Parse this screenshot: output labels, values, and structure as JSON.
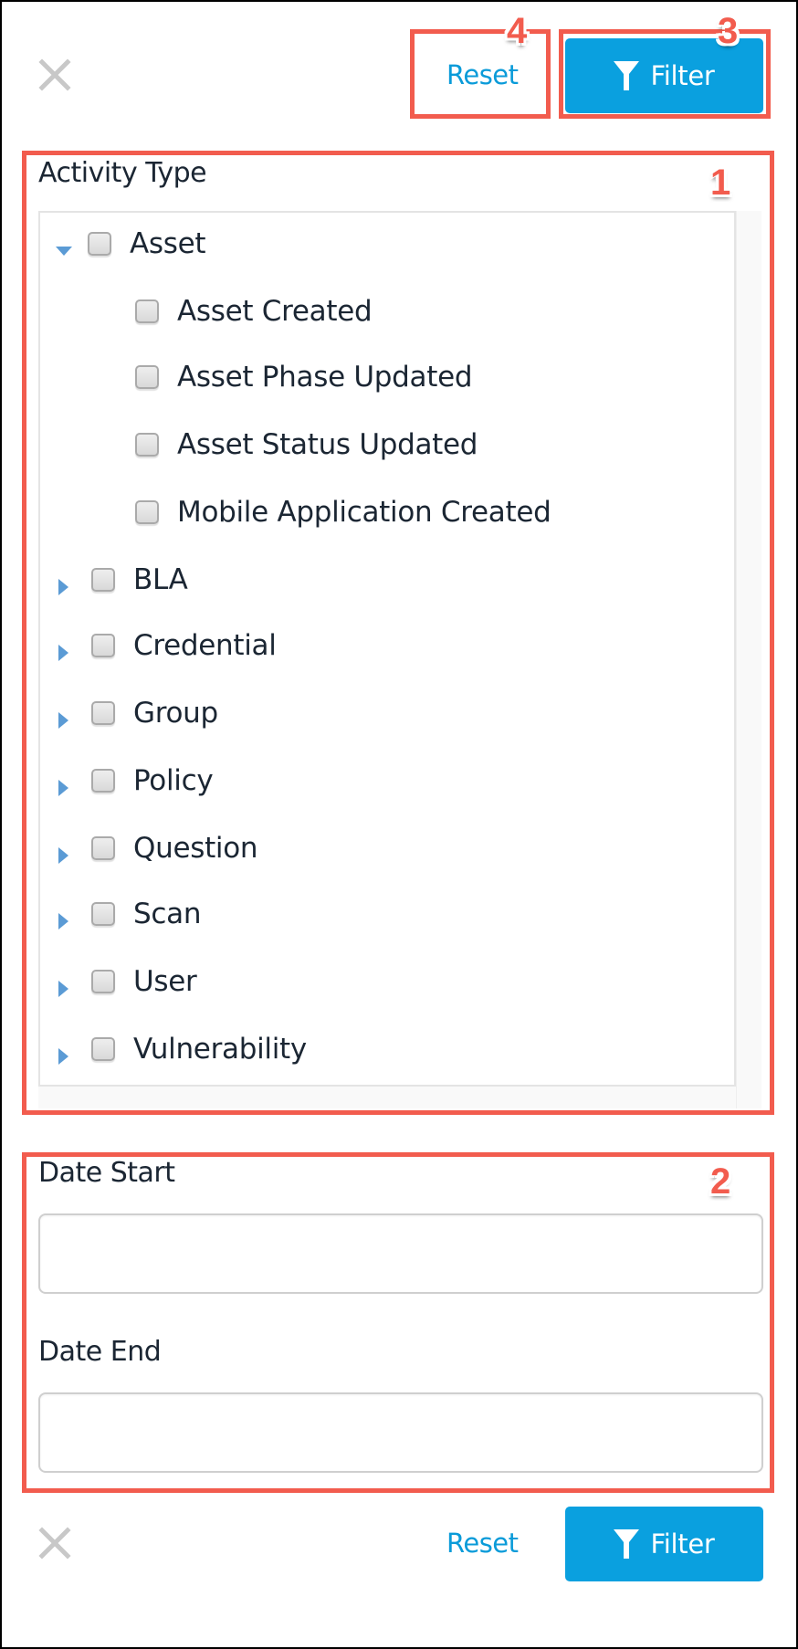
{
  "header": {
    "close_icon": "close-x-icon",
    "reset_label": "Reset",
    "filter_label": "Filter",
    "filter_icon": "funnel-icon"
  },
  "annotations": {
    "box1": "1",
    "box2": "2",
    "box3": "3",
    "box4": "4",
    "color": "#f25c4e"
  },
  "activity_type": {
    "label": "Activity Type",
    "tree": [
      {
        "label": "Asset",
        "expanded": true,
        "checked": false,
        "level": 0
      },
      {
        "label": "Asset Created",
        "checked": false,
        "level": 1
      },
      {
        "label": "Asset Phase Updated",
        "checked": false,
        "level": 1
      },
      {
        "label": "Asset Status Updated",
        "checked": false,
        "level": 1
      },
      {
        "label": "Mobile Application Created",
        "checked": false,
        "level": 1
      },
      {
        "label": "BLA",
        "expanded": false,
        "checked": false,
        "level": 0
      },
      {
        "label": "Credential",
        "expanded": false,
        "checked": false,
        "level": 0
      },
      {
        "label": "Group",
        "expanded": false,
        "checked": false,
        "level": 0
      },
      {
        "label": "Policy",
        "expanded": false,
        "checked": false,
        "level": 0
      },
      {
        "label": "Question",
        "expanded": false,
        "checked": false,
        "level": 0
      },
      {
        "label": "Scan",
        "expanded": false,
        "checked": false,
        "level": 0
      },
      {
        "label": "User",
        "expanded": false,
        "checked": false,
        "level": 0
      },
      {
        "label": "Vulnerability",
        "expanded": false,
        "checked": false,
        "level": 0
      }
    ]
  },
  "dates": {
    "start_label": "Date Start",
    "start_value": "",
    "start_placeholder": "",
    "end_label": "Date End",
    "end_value": "",
    "end_placeholder": ""
  },
  "footer": {
    "close_icon": "close-x-icon",
    "reset_label": "Reset",
    "filter_label": "Filter",
    "filter_icon": "funnel-icon"
  },
  "colors": {
    "accent": "#0aa0df",
    "link": "#0a9bd9",
    "caret": "#5b9bd5",
    "close_icon": "#c8c8c8"
  }
}
